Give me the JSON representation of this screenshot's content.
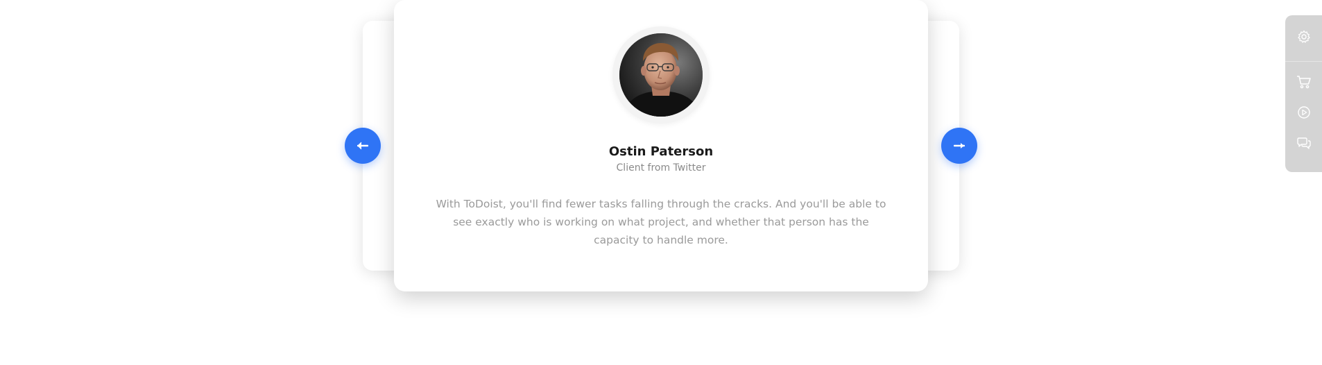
{
  "testimonial": {
    "name": "Ostin Paterson",
    "role": "Client from Twitter",
    "quote": "With ToDoist, you'll find fewer tasks falling through the cracks. And you'll be able to see exactly who is working on what project, and whether that person has the capacity to handle more."
  },
  "navigation": {
    "prev_icon": "arrow-left-icon",
    "next_icon": "arrow-right-icon"
  },
  "side_panel": {
    "items": [
      {
        "icon": "gear-icon"
      },
      {
        "icon": "cart-icon"
      },
      {
        "icon": "play-icon"
      },
      {
        "icon": "chat-icon"
      }
    ]
  },
  "colors": {
    "accent": "#2f74f5",
    "side_panel_bg": "#d4d4d4",
    "name_text": "#1a1a1a",
    "muted_text": "#9a9a9a"
  }
}
